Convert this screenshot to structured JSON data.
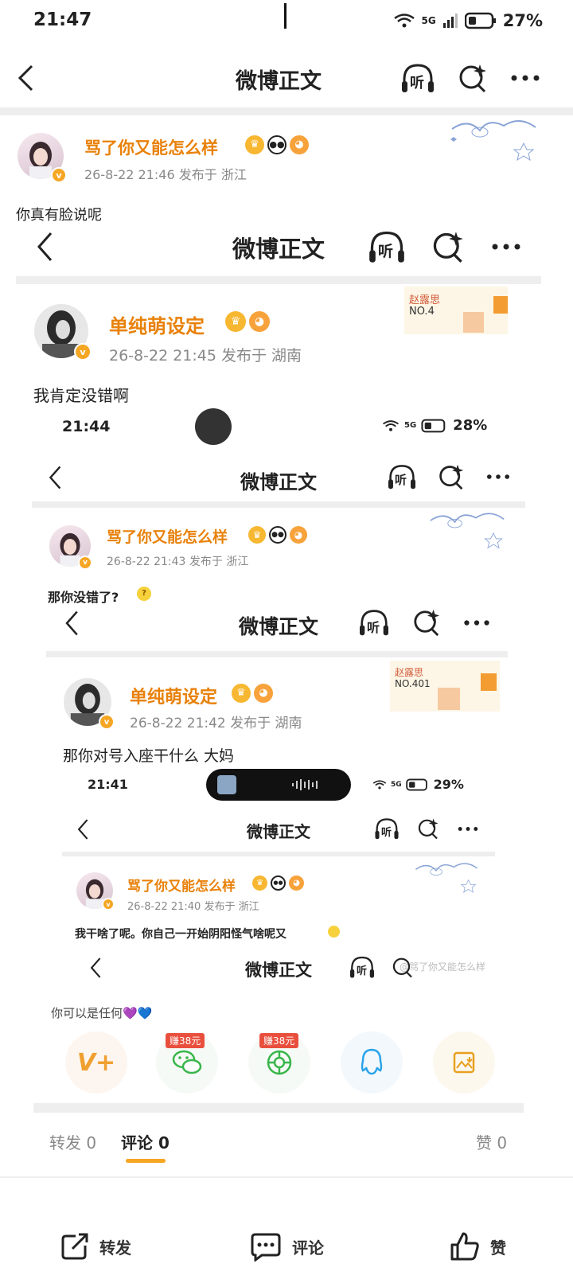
{
  "status_bar": {
    "time": "21:47",
    "network": "5G",
    "battery": "27%"
  },
  "header": {
    "title": "微博正文",
    "listen_label": "听"
  },
  "post1": {
    "username": "骂了你又能怎么样",
    "meta": "26-8-22 21:46  发布于 浙江",
    "text": "你真有脸说呢"
  },
  "shot1": {
    "header_title": "微博正文",
    "listen_label": "听",
    "username": "单纯萌设定",
    "meta": "26-8-22 21:45  发布于 湖南",
    "text": "我肯定没错啊",
    "stamp_name": "赵露思",
    "stamp_no": "NO.4"
  },
  "shot2": {
    "status_time": "21:44",
    "battery": "28%",
    "network": "5G",
    "header_title": "微博正文",
    "listen_label": "听",
    "username": "骂了你又能怎么样",
    "meta": "26-8-22 21:43  发布于 浙江",
    "text": "那你没错了?"
  },
  "shot3": {
    "header_title": "微博正文",
    "listen_label": "听",
    "username": "单纯萌设定",
    "meta": "26-8-22 21:42  发布于 湖南",
    "text": "那你对号入座干什么 大妈",
    "stamp_name": "赵露思",
    "stamp_no": "NO.401"
  },
  "shot4": {
    "status_time": "21:41",
    "battery": "29%",
    "network": "5G",
    "header_title": "微博正文",
    "listen_label": "听",
    "username": "骂了你又能怎么样",
    "meta": "26-8-22 21:40  发布于 浙江",
    "text": "我干啥了呢。你自己一开始阴阳怪气啥呢又"
  },
  "shot5": {
    "header_title": "微博正文",
    "listen_label": "听",
    "watermark": "@骂了你又能怎么样",
    "text": "你可以是任何💜💙"
  },
  "share": {
    "reward_1": "赚38元",
    "reward_2": "赚38元"
  },
  "tabs": {
    "repost": "转发 0",
    "comment": "评论 0",
    "like": "赞 0"
  },
  "bottom": {
    "repost": "转发",
    "comment": "评论",
    "like": "赞"
  },
  "colors": {
    "username": "#e8810a",
    "accent": "#f5a623",
    "reward": "#e94f3d"
  }
}
